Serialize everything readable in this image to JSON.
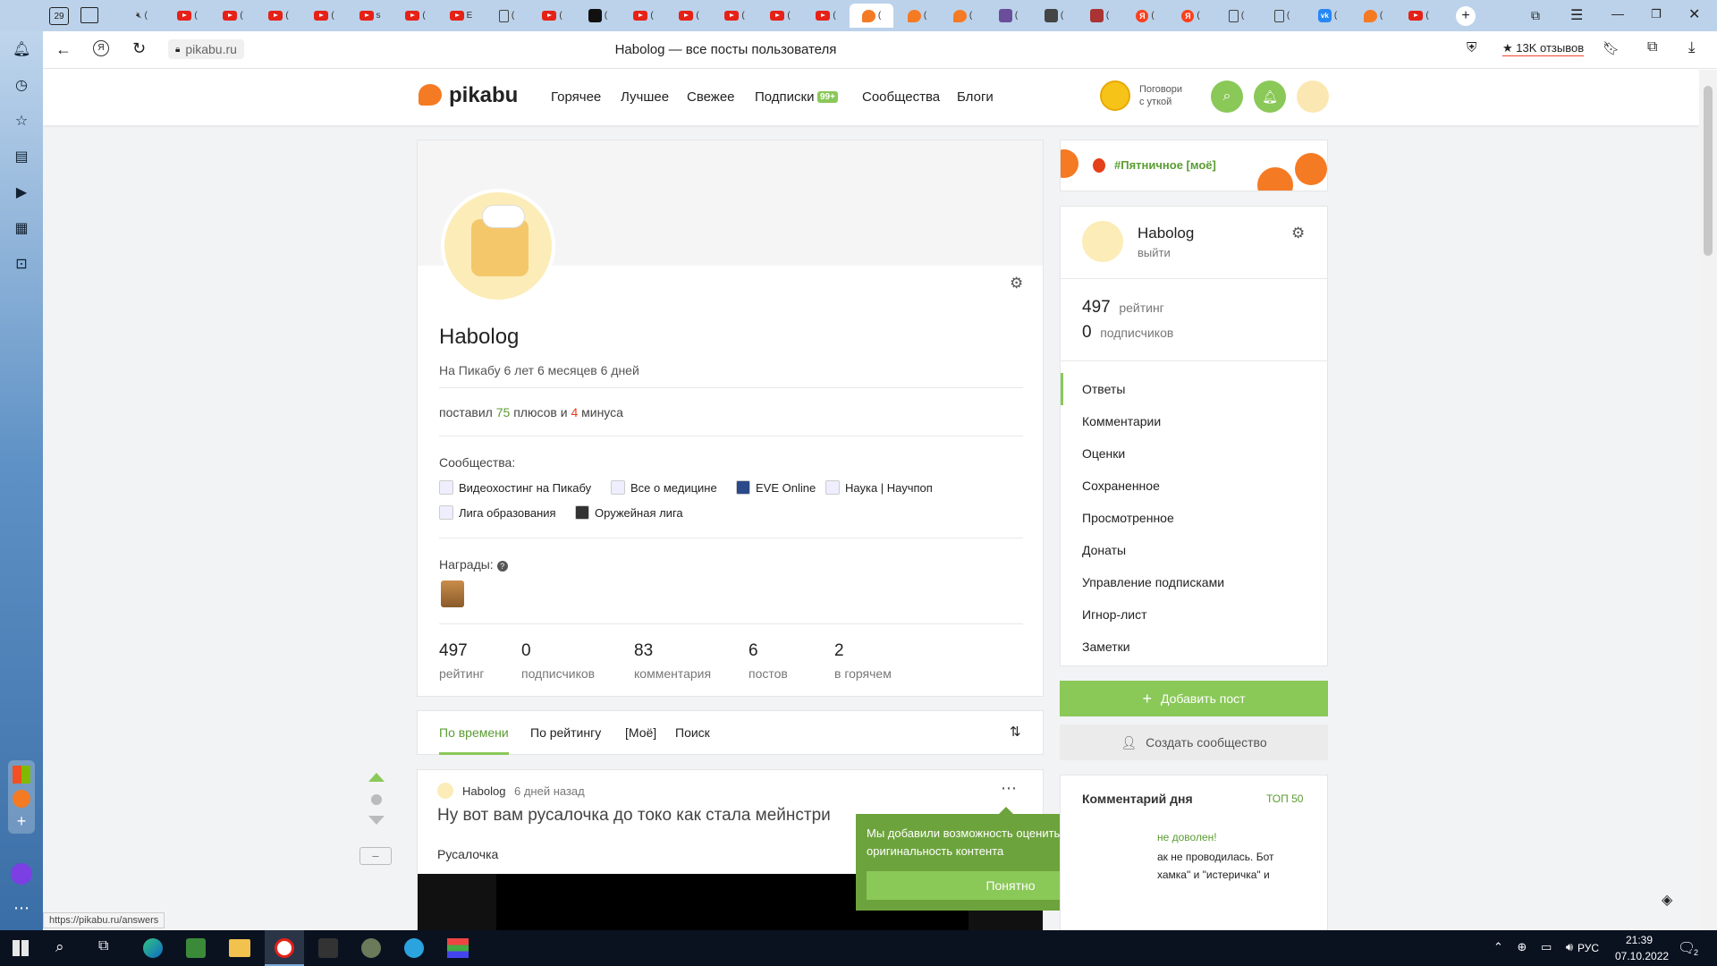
{
  "browser": {
    "tab_count_badge": "29",
    "window_title": "Habolog — все посты пользователя",
    "url": "pikabu.ru",
    "reviews_label": "13K отзывов",
    "status_url": "https://pikabu.ru/answers",
    "tab_captions": [
      "(",
      "(",
      "(",
      "(",
      "(",
      "s",
      "(",
      "E",
      "(",
      "(",
      "(",
      "(",
      "(",
      "(",
      "(",
      "(",
      "(",
      "(",
      "(",
      "(",
      "(",
      "(",
      "(",
      "(",
      "(",
      "(",
      "(",
      "(",
      "(",
      "(",
      "(",
      "(",
      "(",
      "(",
      "(",
      "(",
      "(",
      "(",
      "(",
      "(",
      "(",
      "(",
      "(",
      "(",
      "(",
      "("
    ]
  },
  "site": {
    "logo": "pikabu",
    "nav": [
      "Горячее",
      "Лучшее",
      "Свежее",
      "Подписки",
      "Сообщества",
      "Блоги"
    ],
    "subs_badge": "99+",
    "duck_line1": "Поговори",
    "duck_line2": "с уткой"
  },
  "profile": {
    "name": "Habolog",
    "tenure": "На Пикабу 6 лет 6 месяцев 6 дней",
    "votes_prefix": "поставил",
    "plus_count": "75",
    "plus_word": "плюсов и",
    "minus_count": "4",
    "minus_word": "минуса",
    "communities_label": "Сообщества:",
    "communities": [
      "Видеохостинг на Пикабу",
      "Все о медицине",
      "EVE Online",
      "Наука | Научпоп",
      "Лига образования",
      "Оружейная лига"
    ],
    "awards_label": "Награды:",
    "stats": [
      {
        "value": "497",
        "label": "рейтинг"
      },
      {
        "value": "0",
        "label": "подписчиков"
      },
      {
        "value": "83",
        "label": "комментария"
      },
      {
        "value": "6",
        "label": "постов"
      },
      {
        "value": "2",
        "label": "в горячем"
      }
    ]
  },
  "filters": {
    "tabs": [
      "По времени",
      "По рейтингу",
      "[Моё]",
      "Поиск"
    ],
    "active": 0
  },
  "post": {
    "author": "Habolog",
    "time": "6 дней назад",
    "title": "Ну вот вам русалочка до токо как стала мейнстри",
    "tag": "Русалочка",
    "minus_label": "–"
  },
  "tooltip": {
    "text": "Мы добавили возможность оценить оригинальность контента",
    "button": "Понятно"
  },
  "right": {
    "banner_tag": "#Пятничное [моё]",
    "user_name": "Habolog",
    "logout": "выйти",
    "rating_value": "497",
    "rating_label": "рейтинг",
    "subs_value": "0",
    "subs_label": "подписчиков",
    "menu": [
      "Ответы",
      "Комментарии",
      "Оценки",
      "Сохраненное",
      "Просмотренное",
      "Донаты",
      "Управление подписками",
      "Игнор-лист",
      "Заметки"
    ],
    "menu_active": 0,
    "add_post": "Добавить пост",
    "create_community": "Создать сообщество",
    "comment_of_day": "Комментарий дня",
    "top50": "ТОП 50",
    "comment_snip1": "не доволен!",
    "comment_snip2": "ак не проводилась. Бот",
    "comment_snip3": "хамка\" и \"истеричка\" и"
  },
  "taskbar": {
    "lang": "РУС",
    "time": "21:39",
    "date": "07.10.2022",
    "notif": "2"
  },
  "colors": {
    "pikabu_green": "#8ac858",
    "tooltip_bg": "#6da33d",
    "accent_orange": "#f57a24"
  }
}
